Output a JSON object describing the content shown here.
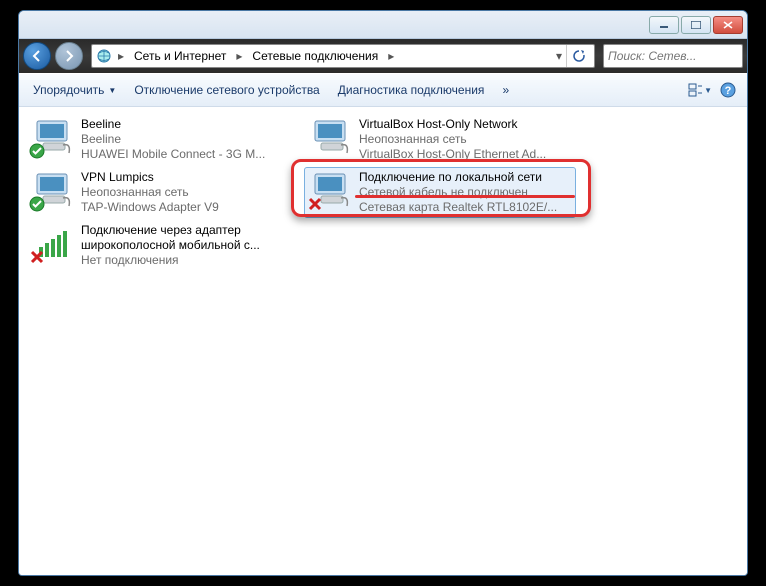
{
  "breadcrumb": {
    "root_icon": "network-center-icon",
    "part1": "Сеть и Интернет",
    "part2": "Сетевые подключения"
  },
  "search": {
    "placeholder": "Поиск: Сетев..."
  },
  "toolbar": {
    "organize": "Упорядочить",
    "disable": "Отключение сетевого устройства",
    "diagnose": "Диагностика подключения",
    "more": "»"
  },
  "items": {
    "col1": [
      {
        "name": "Beeline",
        "line2": "Beeline",
        "line3": "HUAWEI Mobile Connect - 3G M...",
        "badge": "check"
      },
      {
        "name": "VPN Lumpics",
        "line2": "Неопознанная сеть",
        "line3": "TAP-Windows Adapter V9",
        "badge": "check"
      },
      {
        "name": "Подключение через адаптер широкополосной мобильной с...",
        "line2": "",
        "line3": "Нет подключения",
        "badge": "x",
        "bars": true
      }
    ],
    "col2": [
      {
        "name": "VirtualBox Host-Only Network",
        "line2": "Неопознанная сеть",
        "line3": "VirtualBox Host-Only Ethernet Ad...",
        "badge": "none"
      },
      {
        "name": "Подключение по локальной сети",
        "line2": "Сетевой кабель не подключен",
        "line3": "Сетевая карта Realtek RTL8102E/...",
        "badge": "x",
        "selected": true
      }
    ]
  }
}
